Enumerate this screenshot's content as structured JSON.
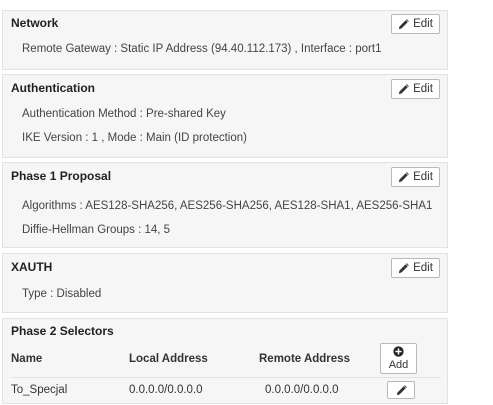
{
  "network": {
    "title": "Network",
    "edit_label": "Edit",
    "remote_gateway": "Remote Gateway : Static IP Address (94.40.112.173) , Interface : port1"
  },
  "authentication": {
    "title": "Authentication",
    "edit_label": "Edit",
    "method": "Authentication Method : Pre-shared Key",
    "ike": "IKE Version : 1 , Mode : Main (ID protection)"
  },
  "phase1": {
    "title": "Phase 1 Proposal",
    "edit_label": "Edit",
    "algorithms": "Algorithms : AES128-SHA256, AES256-SHA256, AES128-SHA1, AES256-SHA1",
    "dh_groups": "Diffie-Hellman Groups : 14, 5"
  },
  "xauth": {
    "title": "XAUTH",
    "edit_label": "Edit",
    "type": "Type : Disabled"
  },
  "phase2": {
    "title": "Phase 2 Selectors",
    "columns": [
      "Name",
      "Local Address",
      "Remote Address"
    ],
    "add_label": "Add",
    "rows": [
      {
        "name": "To_Specjal",
        "local": "0.0.0.0/0.0.0.0",
        "remote": "0.0.0.0/0.0.0.0"
      }
    ]
  },
  "icons": {
    "edit": "pencil-icon",
    "add": "plus-circle-icon"
  },
  "colors": {
    "section_bg": "#f6f6f6",
    "section_border": "#e2e2e2",
    "button_border": "#b9b9b9"
  }
}
